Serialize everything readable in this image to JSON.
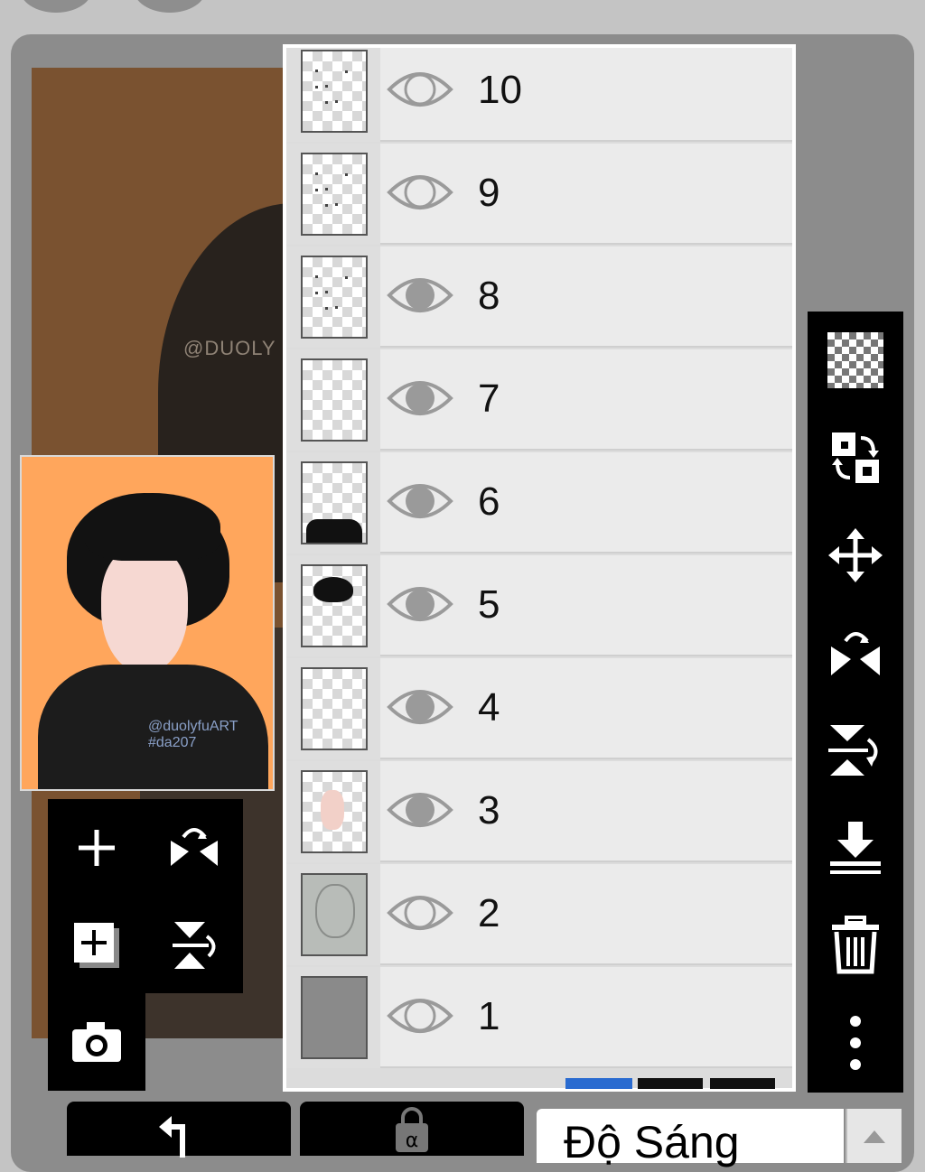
{
  "layers_panel": {
    "layers": [
      {
        "name": "10",
        "visible": false,
        "thumb": "sparse"
      },
      {
        "name": "9",
        "visible": false,
        "thumb": "sparse"
      },
      {
        "name": "8",
        "visible": true,
        "thumb": "sparse"
      },
      {
        "name": "7",
        "visible": true,
        "thumb": "empty"
      },
      {
        "name": "6",
        "visible": true,
        "thumb": "shirt"
      },
      {
        "name": "5",
        "visible": true,
        "thumb": "hair"
      },
      {
        "name": "4",
        "visible": true,
        "thumb": "empty"
      },
      {
        "name": "3",
        "visible": true,
        "thumb": "face"
      },
      {
        "name": "2",
        "visible": false,
        "thumb": "sketch"
      },
      {
        "name": "1",
        "visible": false,
        "thumb": "gray"
      }
    ]
  },
  "canvas": {
    "watermark": "@DUOLY",
    "preview_signature": "@duolyfuART\n#da207"
  },
  "blend_mode": {
    "label": "Độ Sáng"
  },
  "colors": {
    "background_canvas": "#7a5230",
    "preview_bg": "#ffa65c",
    "toolbar": "#000000",
    "panel": "#8c8c8c"
  },
  "icons": {
    "left_tools": [
      "add-layer-icon",
      "flip-horizontal-icon",
      "add-layer-copy-icon",
      "flip-vertical-icon",
      "camera-icon"
    ],
    "right_tools": [
      "transparency-icon",
      "swap-layers-icon",
      "move-icon",
      "flip-horizontal-icon",
      "flip-vertical-icon",
      "merge-down-icon",
      "trash-icon",
      "more-options-icon"
    ],
    "bottom": [
      "undo-icon",
      "alpha-lock-icon",
      "chevron-up-icon"
    ]
  }
}
